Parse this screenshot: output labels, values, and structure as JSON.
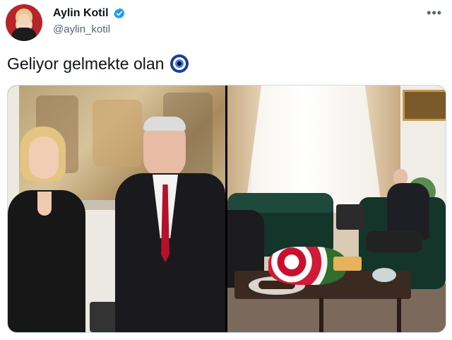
{
  "author": {
    "display_name": "Aylin Kotil",
    "handle": "@aylin_kotil",
    "avatar_icon": "profile-photo",
    "verified_icon": "verified-badge-icon"
  },
  "menu": {
    "more_icon": "more-options-icon",
    "more_glyph": "•••"
  },
  "tweet": {
    "text": "Geliyor gelmekte olan",
    "emoji_icon": "nazar-amulet-icon"
  },
  "media": {
    "photos": [
      {
        "name": "photo-handshake-portrait"
      },
      {
        "name": "photo-meeting-room"
      }
    ]
  },
  "colors": {
    "text_primary": "#0f1419",
    "text_secondary": "#536471",
    "verified_blue": "#1d9bf0"
  }
}
